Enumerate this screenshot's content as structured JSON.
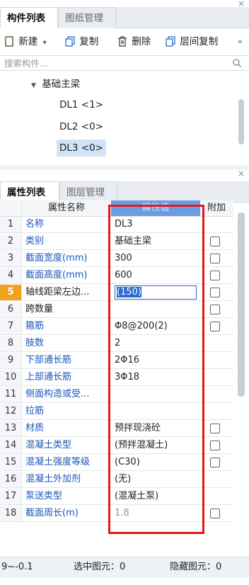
{
  "top_panel": {
    "tabs": [
      {
        "label": "构件列表",
        "active": true
      },
      {
        "label": "图纸管理",
        "active": false
      }
    ],
    "toolbar": {
      "new_label": "新建",
      "copy_label": "复制",
      "delete_label": "删除",
      "floor_copy_label": "层间复制",
      "more_icon": "»"
    },
    "search": {
      "placeholder": "搜索构件..."
    },
    "tree": {
      "group_label": "基础主梁",
      "items": [
        {
          "label": "DL1 <1>",
          "selected": false
        },
        {
          "label": "DL2 <0>",
          "selected": false
        },
        {
          "label": "DL3 <0>",
          "selected": true
        }
      ]
    }
  },
  "bottom_panel": {
    "tabs": [
      {
        "label": "属性列表",
        "active": true
      },
      {
        "label": "图层管理",
        "active": false
      }
    ],
    "headers": {
      "name": "属性名称",
      "value": "属性值",
      "extra": "附加"
    },
    "rows": [
      {
        "idx": "1",
        "name": "名称",
        "value": "DL3",
        "checkbox": false,
        "blue": true
      },
      {
        "idx": "2",
        "name": "类别",
        "value": "基础主梁",
        "checkbox": true,
        "blue": true
      },
      {
        "idx": "3",
        "name": "截面宽度(mm)",
        "value": "300",
        "checkbox": true,
        "blue": true
      },
      {
        "idx": "4",
        "name": "截面高度(mm)",
        "value": "600",
        "checkbox": true,
        "blue": true
      },
      {
        "idx": "5",
        "name": "轴线距梁左边...",
        "value": "(150)",
        "checkbox": true,
        "blue": false,
        "selected": true
      },
      {
        "idx": "6",
        "name": "跨数量",
        "value": "",
        "checkbox": true,
        "blue": false
      },
      {
        "idx": "7",
        "name": "箍筋",
        "value": "Φ8@200(2)",
        "checkbox": true,
        "blue": true
      },
      {
        "idx": "8",
        "name": "肢数",
        "value": "2",
        "checkbox": false,
        "blue": true
      },
      {
        "idx": "9",
        "name": "下部通长筋",
        "value": "2Φ16",
        "checkbox": false,
        "blue": true
      },
      {
        "idx": "10",
        "name": "上部通长筋",
        "value": "3Φ18",
        "checkbox": false,
        "blue": true
      },
      {
        "idx": "11",
        "name": "侧面构造或受...",
        "value": "",
        "checkbox": false,
        "blue": true
      },
      {
        "idx": "12",
        "name": "拉筋",
        "value": "",
        "checkbox": false,
        "blue": true
      },
      {
        "idx": "13",
        "name": "材质",
        "value": "预拌现浇砼",
        "checkbox": true,
        "blue": true
      },
      {
        "idx": "14",
        "name": "混凝土类型",
        "value": "(预拌混凝土)",
        "checkbox": true,
        "blue": true
      },
      {
        "idx": "15",
        "name": "混凝土强度等级",
        "value": "(C30)",
        "checkbox": true,
        "blue": true
      },
      {
        "idx": "16",
        "name": "混凝土外加剂",
        "value": "(无)",
        "checkbox": false,
        "blue": true
      },
      {
        "idx": "17",
        "name": "泵送类型",
        "value": "(混凝土泵)",
        "checkbox": false,
        "blue": true
      },
      {
        "idx": "18",
        "name": "截面周长(m)",
        "value": "1.8",
        "checkbox": true,
        "blue": true,
        "value_gray": true
      }
    ]
  },
  "status_bar": {
    "left": "9~-0.1",
    "selected": "选中图元：0",
    "hidden": "隐藏图元：0"
  },
  "colors": {
    "accent_blue": "#1a56b8",
    "highlight_red": "#e0191b",
    "selected_bg": "#cfe4f7"
  }
}
